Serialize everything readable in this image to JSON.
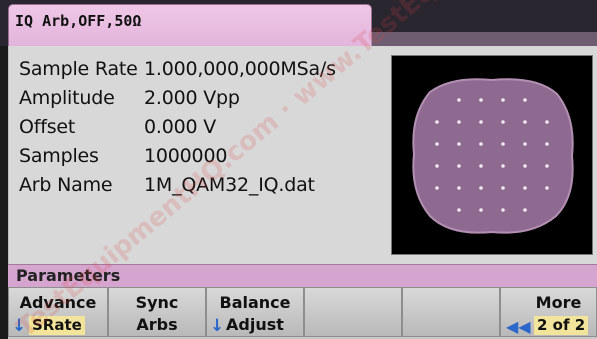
{
  "channel_tab": {
    "label": "IQ Arb,OFF,50Ω"
  },
  "params": [
    {
      "label": "Sample Rate",
      "value": "1.000,000,000MSa/s"
    },
    {
      "label": "Amplitude",
      "value": "2.000 Vpp"
    },
    {
      "label": "Offset",
      "value": "0.000 V"
    },
    {
      "label": "Samples",
      "value": "1000000"
    },
    {
      "label": "Arb Name",
      "value": "1M_QAM32_IQ.dat"
    }
  ],
  "preview": {
    "icon": "qam-constellation-preview",
    "fill_color": "#8e6a90",
    "point_color": "#f0e8f0",
    "background": "#000000"
  },
  "section_header": "Parameters",
  "softkeys": {
    "advance": {
      "label": "Advance",
      "value": "SRate"
    },
    "sync_arbs": {
      "line1": "Sync",
      "line2": "Arbs"
    },
    "balance_adjust": {
      "line1": "Balance",
      "line2": "Adjust"
    },
    "more": {
      "label": "More",
      "page": "2 of 2"
    }
  },
  "watermark": "TestEquipmentHQ.com · www.TestEquipment for Sale",
  "colors": {
    "tab_pink": "#e8bde0",
    "header_purple": "#d6a5cf",
    "panel_gray": "#d8d8d8",
    "arrow_blue": "#2b67c9",
    "highlight_yellow": "#f2e49a"
  }
}
